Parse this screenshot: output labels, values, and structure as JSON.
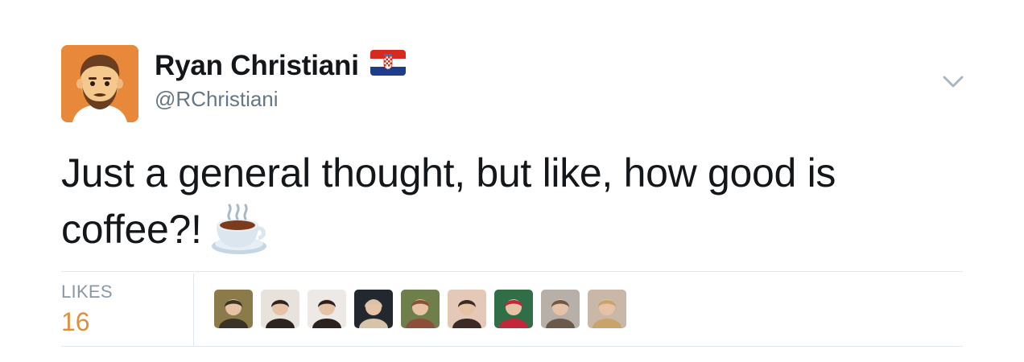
{
  "author": {
    "display_name": "Ryan Christiani",
    "handle": "@RChristiani",
    "avatar_icon": "cartoon-face-avatar",
    "flag_icon": "croatia-flag-icon"
  },
  "tweet": {
    "text": "Just a general thought, but like, how good is coffee?!",
    "emoji_icon": "hot-beverage-icon"
  },
  "stats": {
    "likes_label": "LIKES",
    "likes_count": "16"
  },
  "likers": [
    {
      "name": "liker-avatar-1",
      "bg": "#8B7A4A",
      "fg": "#3a3326"
    },
    {
      "name": "liker-avatar-2",
      "bg": "#E8E2DC",
      "fg": "#2b2420"
    },
    {
      "name": "liker-avatar-3",
      "bg": "#EDE9E6",
      "fg": "#2a2220"
    },
    {
      "name": "liker-avatar-4",
      "bg": "#23282E",
      "fg": "#d7c3a8"
    },
    {
      "name": "liker-avatar-5",
      "bg": "#6E7F4C",
      "fg": "#8d4f3a"
    },
    {
      "name": "liker-avatar-6",
      "bg": "#E4C9B8",
      "fg": "#3c2a26"
    },
    {
      "name": "liker-avatar-7",
      "bg": "#2F6E47",
      "fg": "#c4273a"
    },
    {
      "name": "liker-avatar-8",
      "bg": "#B7B0A8",
      "fg": "#6b5a4a"
    },
    {
      "name": "liker-avatar-9",
      "bg": "#C9B8A8",
      "fg": "#c9a46a"
    }
  ],
  "colors": {
    "text": "#14171A",
    "secondary": "#657786",
    "likes_accent": "#E0903A",
    "divider": "#E1E8ED"
  }
}
